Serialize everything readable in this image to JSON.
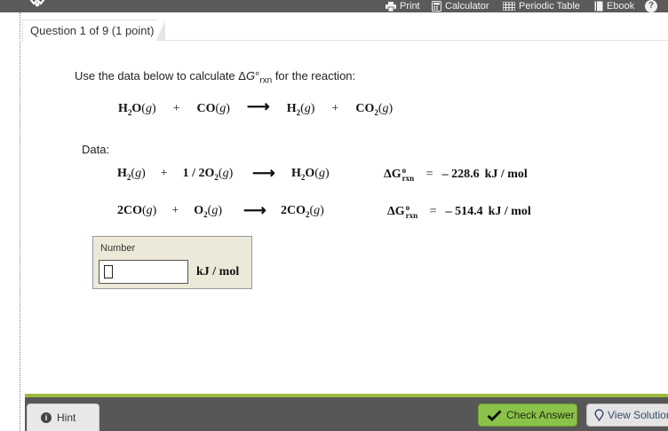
{
  "toolbar": {
    "print": "Print",
    "calculator": "Calculator",
    "periodic_table": "Periodic Table",
    "ebook": "Ebook",
    "help": "?"
  },
  "question_tab": "Question 1 of 9 (1 point)",
  "instructions": {
    "pre": "Use the data below to calculate Δ",
    "G": "G",
    "deg": "°",
    "sub": "rxn",
    "post": " for the reaction:"
  },
  "main_reaction": {
    "lhs1": "H",
    "lhs1_sub": "2",
    "lhs1_rest": "O",
    "lhs1_state": "g",
    "plus1": "+",
    "lhs2": "CO",
    "lhs2_state": "g",
    "arrow": "⟶",
    "rhs1": "H",
    "rhs1_sub": "2",
    "rhs1_state": "g",
    "plus2": "+",
    "rhs2": "CO",
    "rhs2_sub": "2",
    "rhs2_state": "g"
  },
  "data_label": "Data:",
  "data_reactions": [
    {
      "a": "H",
      "a_sub": "2",
      "a_state": "g",
      "plus": "+",
      "b_coef": "1 / 2O",
      "b_sub": "2",
      "b_state": "g",
      "arrow": "⟶",
      "c": "H",
      "c_sub": "2",
      "c_rest": "O",
      "c_state": "g",
      "dg": "ΔG",
      "dg_sup": "o",
      "dg_sub": "rxn",
      "eq": "=",
      "value": "– 228.6",
      "unit": "kJ / mol"
    },
    {
      "a": "2CO",
      "a_state": "g",
      "plus": "+",
      "b": "O",
      "b_sub": "2",
      "b_state": "g",
      "arrow": "⟶",
      "c": "2CO",
      "c_sub": "2",
      "c_state": "g",
      "dg": "ΔG",
      "dg_sup": "o",
      "dg_sub": "rxn",
      "eq": "=",
      "value": "– 514.4",
      "unit": "kJ / mol"
    }
  ],
  "answer": {
    "label": "Number",
    "value": "",
    "unit": "kJ / mol"
  },
  "footer": {
    "hint": "Hint",
    "check_answer": "Check Answer",
    "view_solution": "View Solution"
  }
}
